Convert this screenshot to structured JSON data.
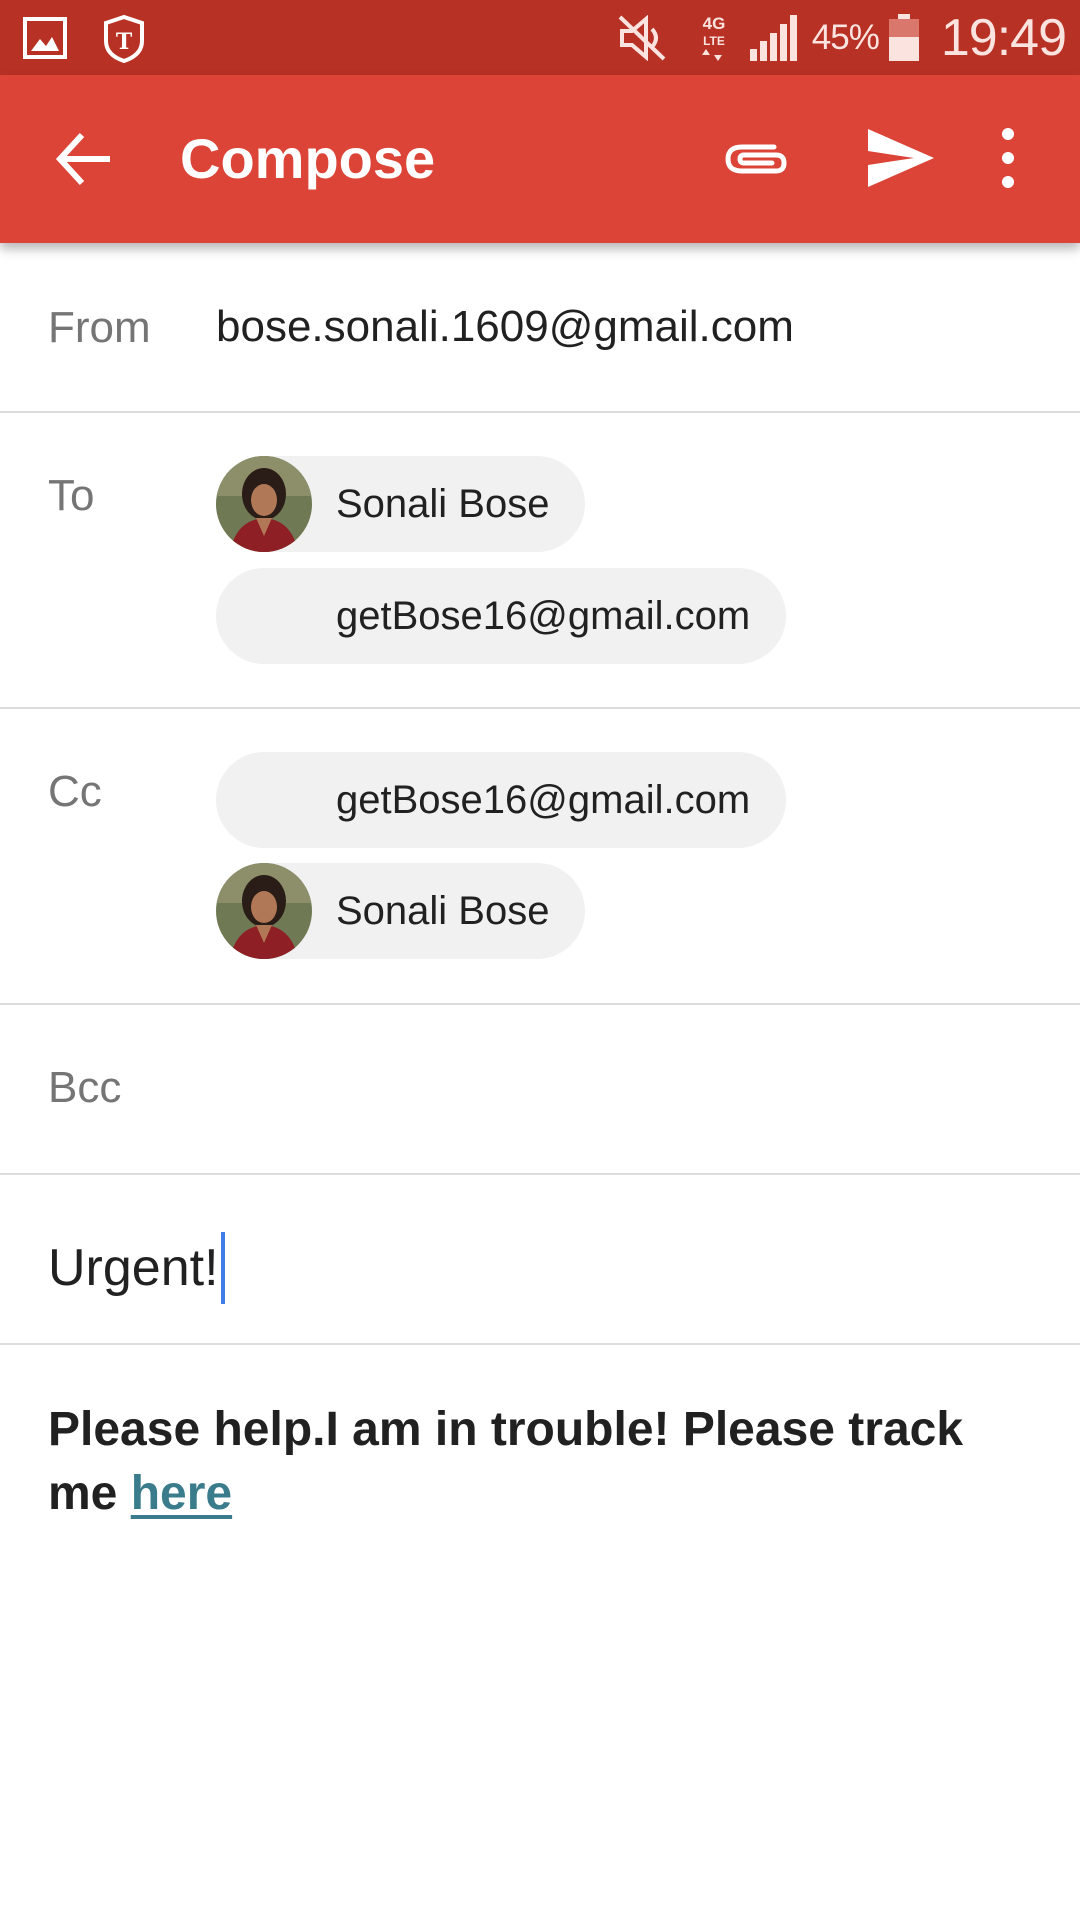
{
  "status_bar": {
    "battery_percent": "45%",
    "time": "19:49",
    "network": "4G LTE",
    "icons": [
      "gallery-icon",
      "t-mobile-app-icon",
      "mute-icon",
      "lte-icon",
      "signal-icon",
      "battery-icon"
    ]
  },
  "app_bar": {
    "title": "Compose",
    "icons": [
      "back-arrow-icon",
      "attach-icon",
      "send-icon",
      "more-options-icon"
    ],
    "background_color": "#db4437"
  },
  "form": {
    "from": {
      "label": "From",
      "value": "bose.sonali.1609@gmail.com"
    },
    "to": {
      "label": "To",
      "recipients": [
        {
          "text": "Sonali Bose",
          "has_avatar": true
        },
        {
          "text": "getBose16@gmail.com",
          "has_avatar": false
        }
      ]
    },
    "cc": {
      "label": "Cc",
      "recipients": [
        {
          "text": "getBose16@gmail.com",
          "has_avatar": false
        },
        {
          "text": "Sonali Bose",
          "has_avatar": true
        }
      ]
    },
    "bcc": {
      "label": "Bcc"
    },
    "subject": {
      "value": "Urgent!"
    },
    "body": {
      "text": "Please help.I am in trouble! Please track me ",
      "link_text": "here"
    }
  },
  "colors": {
    "status_bar": "#b73125",
    "link": "#3b7c8c",
    "caret": "#3f7ee8"
  }
}
